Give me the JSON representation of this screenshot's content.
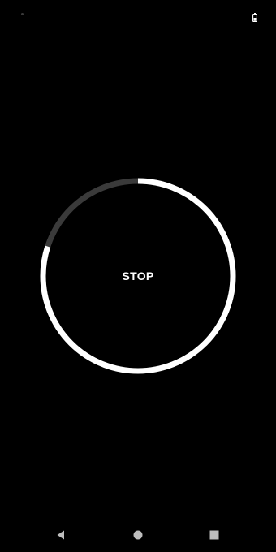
{
  "timer": {
    "button_label": "STOP",
    "progress_fraction": 0.8,
    "track_color": "#3a3a3a",
    "progress_color": "#ffffff"
  },
  "status_bar": {
    "icons": [
      "notification-dot-icon",
      "battery-icon"
    ]
  },
  "nav_bar": {
    "icons": [
      "back-icon",
      "home-icon",
      "recents-icon"
    ],
    "icon_color": "#bdbdbd"
  },
  "colors": {
    "background": "#000000",
    "text": "#ffffff"
  }
}
